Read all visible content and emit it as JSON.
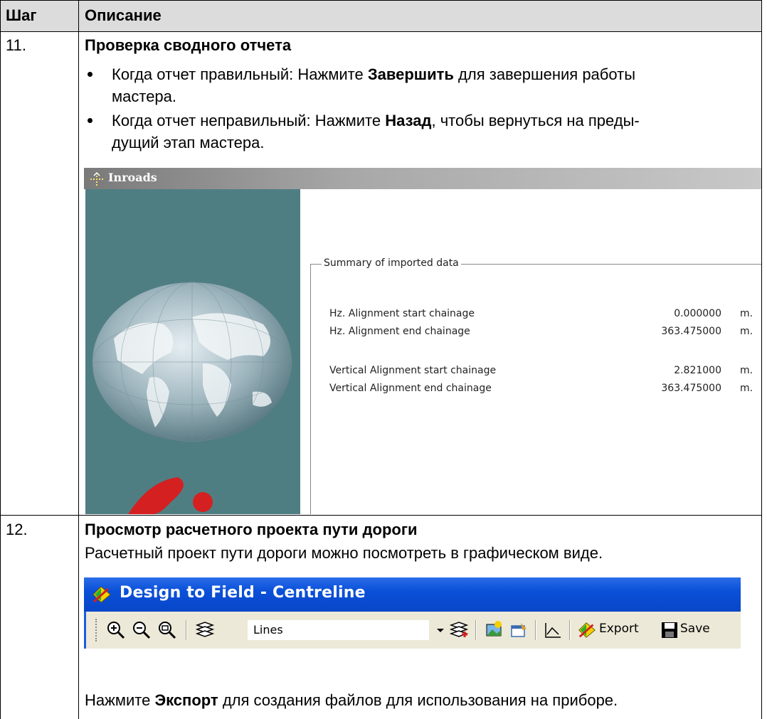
{
  "table": {
    "header": {
      "step": "Шаг",
      "description": "Описание"
    },
    "rows": [
      {
        "step": "11.",
        "heading": "Проверка сводного отчета",
        "bullets": [
          {
            "pre": "Когда отчет правильный: Нажмите ",
            "bold": "Завершить",
            "post": " для завершения работы",
            "line2": "мастера."
          },
          {
            "pre": "Когда отчет неправильный: Нажмите ",
            "bold": "Назад",
            "post": ", чтобы вернуться на преды-",
            "line2": "дущий этап мастера."
          }
        ]
      },
      {
        "step": "12.",
        "heading": "Просмотр расчетного проекта пути дороги",
        "text": "Расчетный проект пути дороги можно посмотреть в графическом виде.",
        "footer": {
          "pre": "Нажмите ",
          "bold": "Экспорт",
          "post": " для создания файлов для использования на приборе."
        }
      }
    ]
  },
  "inroads": {
    "title": "Inroads",
    "group_label": "Summary of imported data",
    "rows": [
      {
        "label": "Hz. Alignment start chainage",
        "value": "0.000000",
        "unit": "m."
      },
      {
        "label": "Hz. Alignment end chainage",
        "value": "363.475000",
        "unit": "m."
      },
      {
        "label": "Vertical Alignment start chainage",
        "value": "2.821000",
        "unit": "m."
      },
      {
        "label": "Vertical Alignment end chainage",
        "value": "363.475000",
        "unit": "m."
      }
    ],
    "colors": {
      "panel": "#4f7e82",
      "logo": "#d42020"
    }
  },
  "dtf": {
    "title": "Design to Field - Centreline",
    "combo_value": "Lines",
    "export_label": "Export",
    "save_label": "Save",
    "colors": {
      "titlebar": "#0a50d8",
      "toolbar": "#ece9d8"
    }
  }
}
